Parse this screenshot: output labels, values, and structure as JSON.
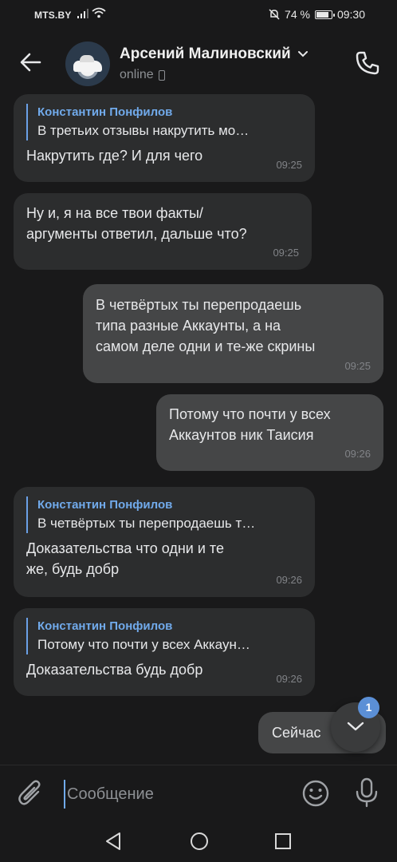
{
  "status_bar": {
    "carrier": "MTS.BY",
    "battery": "74 %",
    "battery_level": 0.74,
    "time": "09:30"
  },
  "header": {
    "name": "Арсений Малиновский",
    "status": "online"
  },
  "messages": [
    {
      "reply_name": "Константин Понфилов",
      "reply_text": "В третьих отзывы накрутить мо…",
      "line1": "Накрутить где? И для чего",
      "line2": "",
      "line3": "",
      "time": "09:25"
    },
    {
      "reply_name": "",
      "reply_text": "",
      "line1": "Ну и, я на все твои факты/",
      "line2": "аргументы ответил, дальше что?",
      "line3": "",
      "time": "09:25"
    },
    {
      "reply_name": "",
      "reply_text": "",
      "line1": "В четвёртых ты перепродаешь",
      "line2": "типа разные Аккаунты, а на",
      "line3": "самом деле одни и те-же скрины",
      "time": "09:25"
    },
    {
      "reply_name": "",
      "reply_text": "",
      "line1": "Потому что почти у всех",
      "line2": "Аккаунтов ник Таисия",
      "line3": "",
      "time": "09:26"
    },
    {
      "reply_name": "Константин Понфилов",
      "reply_text": "В четвёртых ты перепродаешь т…",
      "line1": "Доказательства что одни и те",
      "line2": "же, будь добр",
      "line3": "",
      "time": "09:26"
    },
    {
      "reply_name": "Константин Понфилов",
      "reply_text": "Потому что почти у всех Аккаун…",
      "line1": "Доказательства будь добр",
      "line2": "",
      "line3": "",
      "time": "09:26"
    },
    {
      "reply_name": "",
      "reply_text": "",
      "line1": "Сейчас",
      "line2": "",
      "line3": "",
      "time": ""
    }
  ],
  "scroll_badge": "1",
  "composer": {
    "placeholder": "Сообщение"
  },
  "colors": {
    "accent": "#71aaeb",
    "incoming_bubble": "#2c2d2e",
    "outgoing_bubble": "#454647",
    "background": "#19191a"
  }
}
